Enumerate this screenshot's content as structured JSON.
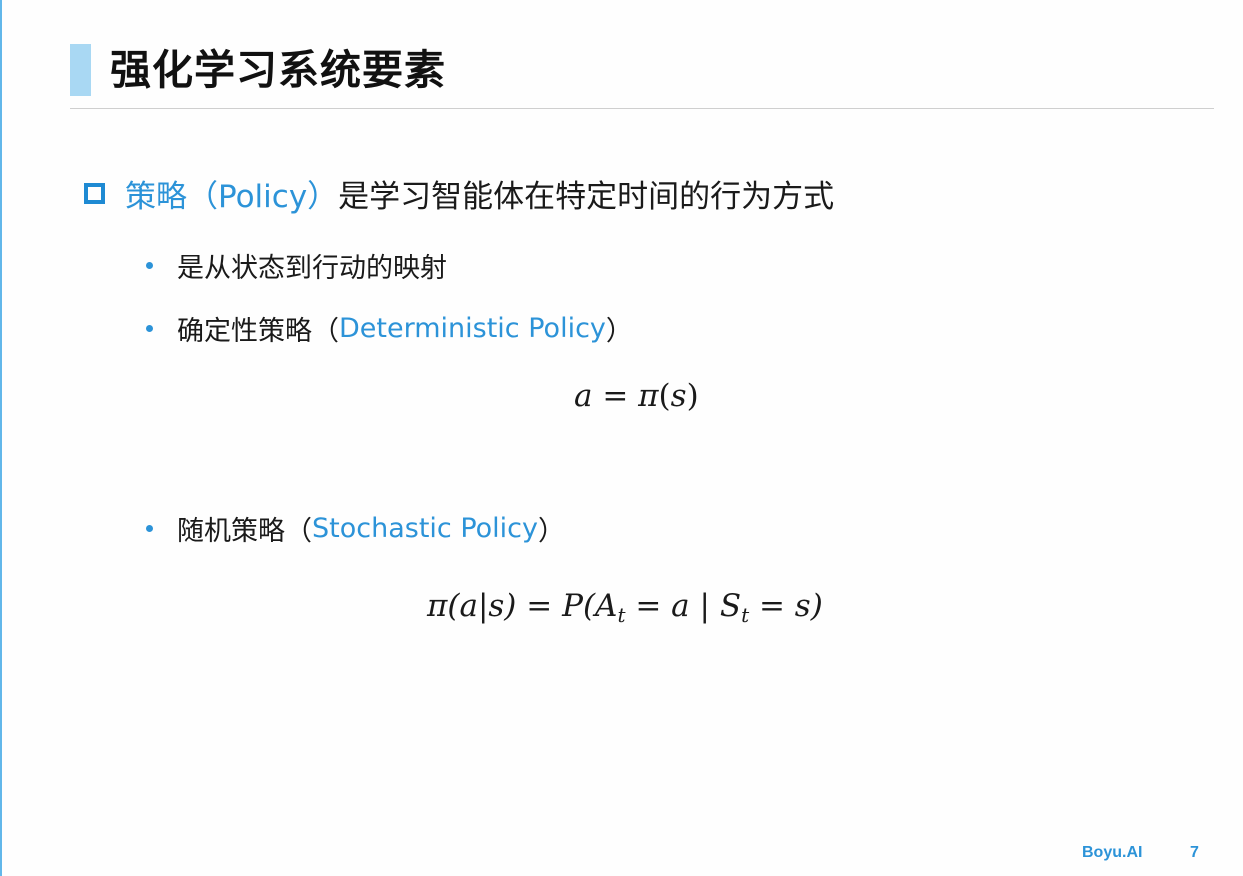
{
  "slide": {
    "title": "强化学习系统要素",
    "main_point": {
      "term": "策略（Policy）",
      "text": "是学习智能体在特定时间的行为方式"
    },
    "bullets": [
      {
        "text": "是从状态到行动的映射"
      },
      {
        "text": "确定性策略（",
        "term": "Deterministic Policy",
        "close": "）"
      },
      {
        "text": "随机策略（",
        "term": "Stochastic Policy",
        "close": "）"
      }
    ],
    "formulas": {
      "deterministic": {
        "a": "a",
        "eq": " = ",
        "pi": "π",
        "open": "(",
        "s": "s",
        "close": ")"
      },
      "stochastic": {
        "lhs": "π(a|s)",
        "eq1": " = ",
        "P": "P(",
        "A": "A",
        "t1": "t",
        "eq2": " = a | ",
        "S": "S",
        "t2": "t",
        "eq3": " = s)"
      }
    },
    "colors": {
      "accent": "#2c93d8",
      "title_bar": "#a9d8f3",
      "left_rule": "#62b7ea"
    }
  },
  "footer": {
    "brand": "Boyu.AI",
    "page_number": "7"
  }
}
